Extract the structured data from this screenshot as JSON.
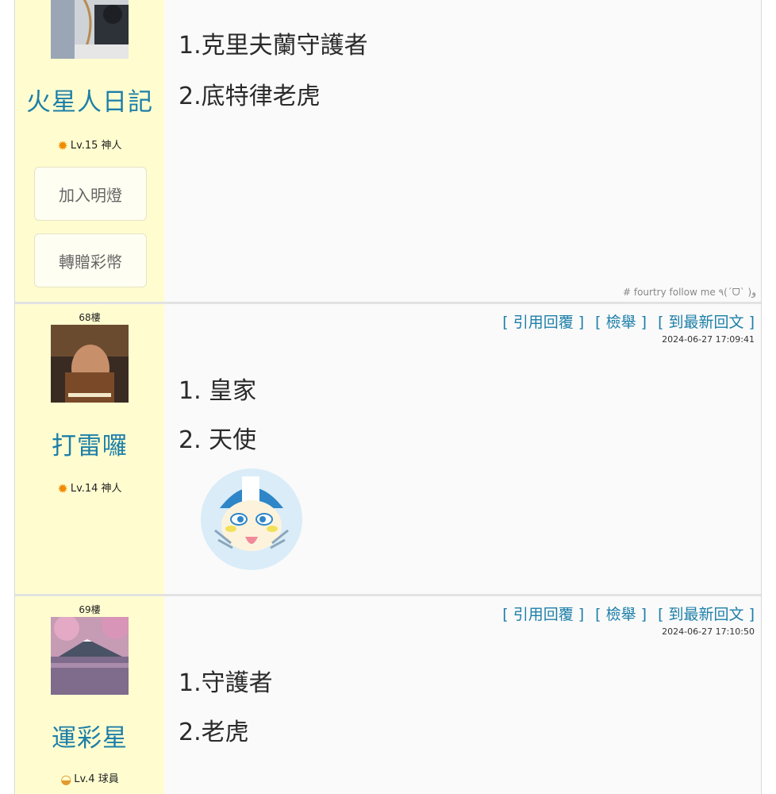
{
  "posts": [
    {
      "floor": "",
      "username": "火星人日記",
      "level": "Lv.15 神人",
      "level_icon": "sun-icon",
      "buttons": [
        "加入明燈",
        "轉贈彩幣"
      ],
      "content": [
        "1.克里夫蘭守護者",
        "2.底特律老虎"
      ],
      "signature": "# fourtry follow me ٩(ˊᗜˋ )و"
    },
    {
      "floor": "68樓",
      "username": "打雷囉",
      "level": "Lv.14 神人",
      "level_icon": "sun-icon",
      "actions": {
        "quote": "引用回覆",
        "report": "檢舉",
        "latest": "到最新回文"
      },
      "time": "2024-06-27 17:09:41",
      "content": [
        "1. 皇家",
        "2. 天使"
      ],
      "sticker": "cartoon-face-sticker"
    },
    {
      "floor": "69樓",
      "username": "運彩星",
      "level": "Lv.4 球員",
      "level_icon": "planet-icon",
      "actions": {
        "quote": "引用回覆",
        "report": "檢舉",
        "latest": "到最新回文"
      },
      "time": "2024-06-27 17:10:50",
      "content": [
        "1.守護者",
        "2.老虎"
      ]
    }
  ],
  "colors": {
    "accent": "#1d7fa8",
    "sidebar": "#fffdd0",
    "separator": "#e2e2e2"
  }
}
